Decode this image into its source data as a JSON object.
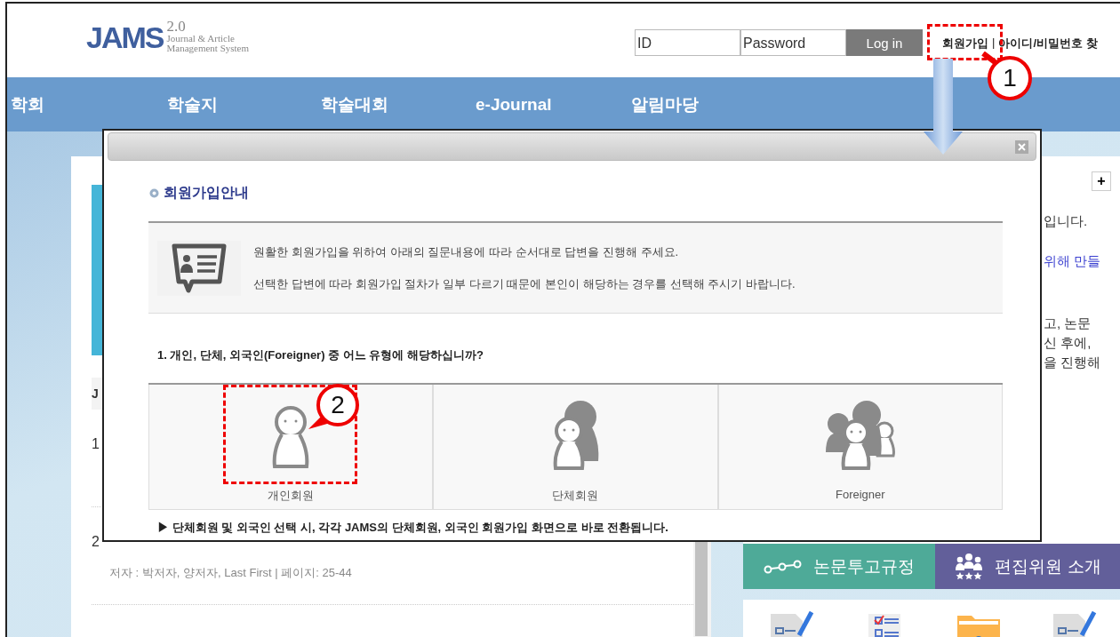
{
  "header": {
    "logo": {
      "name": "JAMS",
      "version": "2.0",
      "tagline": [
        "Journal & Article",
        "Management System"
      ]
    },
    "login": {
      "id_placeholder": "ID",
      "password_placeholder": "Password",
      "button": "Log in"
    },
    "links": [
      "회원가입",
      "아이디/비밀번호 찾"
    ],
    "separator": "|"
  },
  "nav": [
    "학회",
    "학술지",
    "학술대회",
    "e-Journal",
    "알림마당"
  ],
  "list": {
    "heading": "J",
    "items": [
      {
        "number": "1"
      },
      {
        "number": "2",
        "meta": "저자 : 박저자, 양저자, Last First | 페이지: 25-44"
      }
    ]
  },
  "side": {
    "expand": "+",
    "lines": [
      {
        "text": "입니다.",
        "link": false
      },
      {
        "text": "위해 만들",
        "link": true
      },
      {
        "text": "고, 논문",
        "link": false
      },
      {
        "text": "신 후에,",
        "link": false
      },
      {
        "text": "을 진행해",
        "link": false
      }
    ],
    "tabs": [
      {
        "label": "논문투고규정",
        "kind": "steps",
        "color": "#4eaa98"
      },
      {
        "label": "편집위원 소개",
        "kind": "team",
        "color": "#625f9a"
      }
    ]
  },
  "modal": {
    "heading": "회원가입안내",
    "intro": [
      "원활한 회원가입을 위하여 아래의 질문내용에 따라 순서대로 답변을 진행해 주세요.",
      "선택한 답변에 따라 회원가입 절차가 일부 다르기 때문에 본인이 해당하는 경우를 선택해 주시기 바랍니다."
    ],
    "question": "1. 개인, 단체, 외국인(Foreigner) 중 어느 유형에 해당하십니까?",
    "choices": [
      {
        "label": "개인회원",
        "kind": "single"
      },
      {
        "label": "단체회원",
        "kind": "group"
      },
      {
        "label": "Foreigner",
        "kind": "crowd"
      }
    ],
    "note": "▶ 단체회원 및 외국인 선택 시, 각각 JAMS의 단체회원, 외국인 회원가입 화면으로 바로 전환됩니다."
  },
  "annotations": [
    {
      "label": "1"
    },
    {
      "label": "2"
    }
  ]
}
